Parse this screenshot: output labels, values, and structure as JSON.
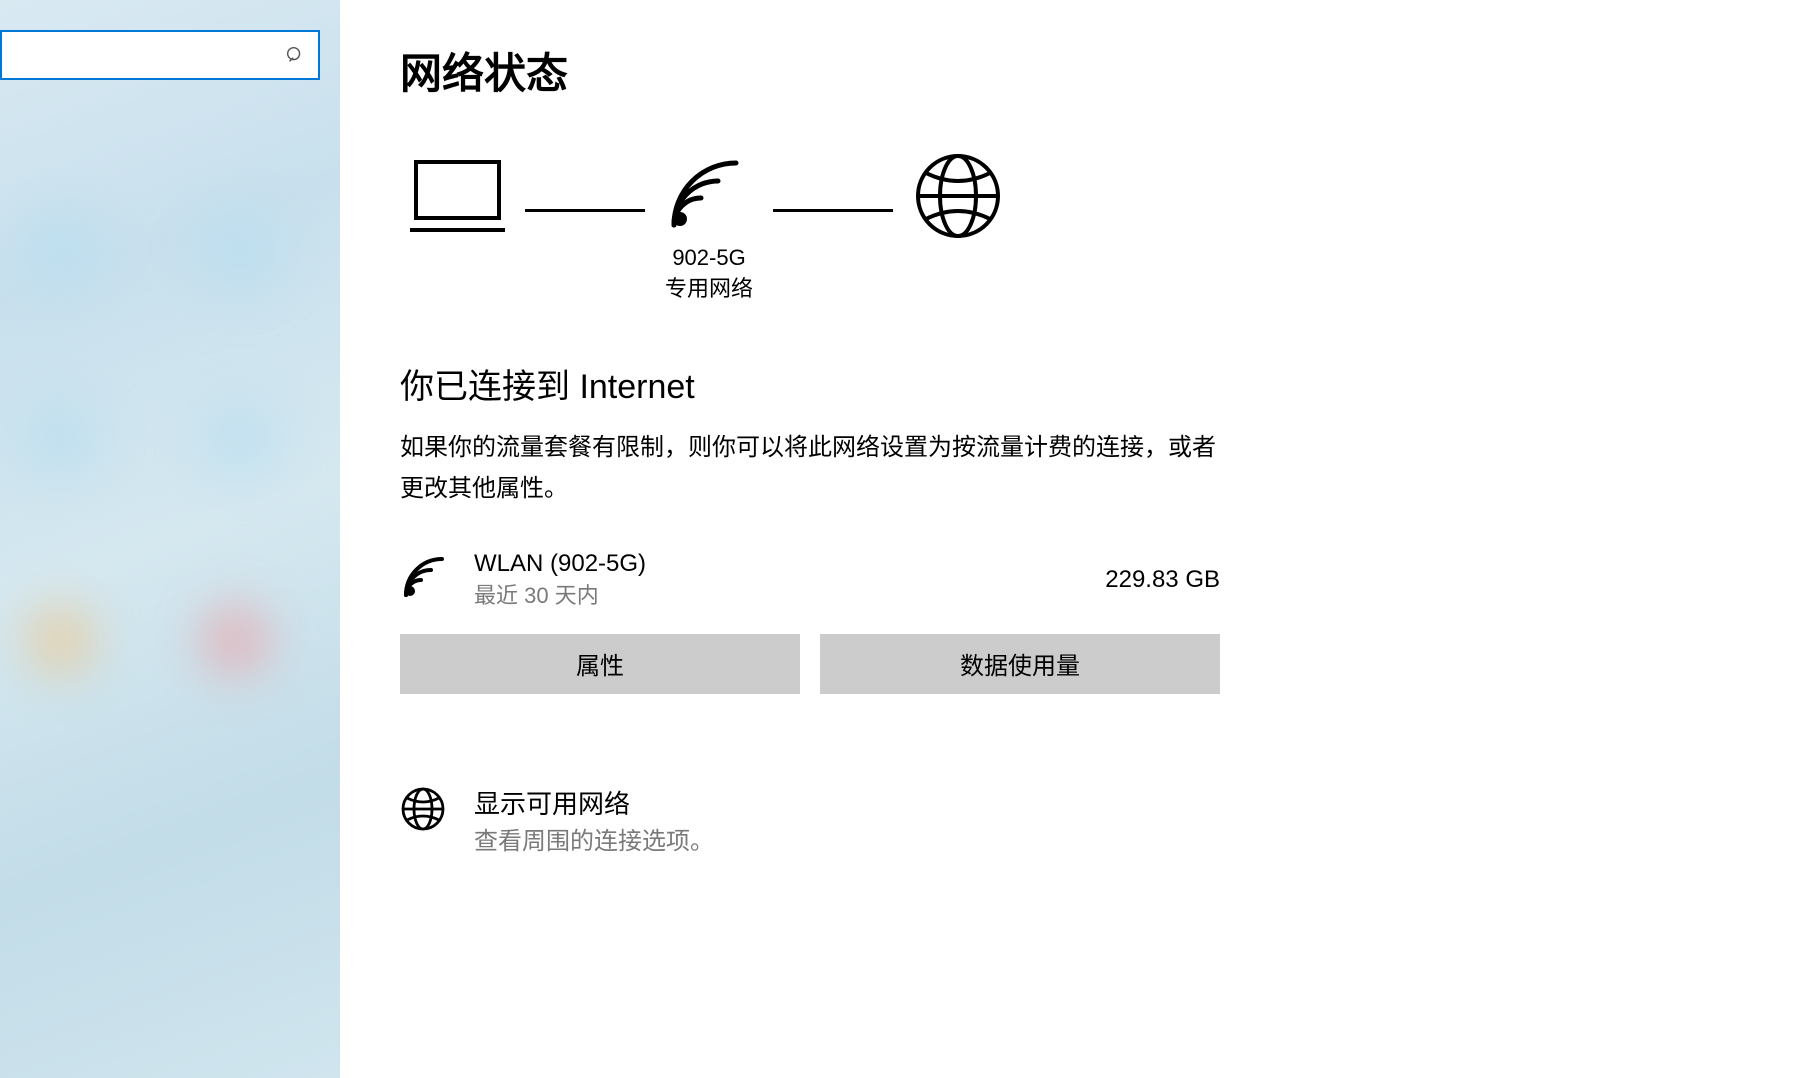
{
  "search": {
    "placeholder": ""
  },
  "page_title": "网络状态",
  "diagram": {
    "wifi_name": "902-5G",
    "wifi_type": "专用网络"
  },
  "connected_heading": "你已连接到 Internet",
  "description": "如果你的流量套餐有限制，则你可以将此网络设置为按流量计费的连接，或者更改其他属性。",
  "network": {
    "name": "WLAN (902-5G)",
    "period": "最近 30 天内",
    "usage": "229.83 GB"
  },
  "buttons": {
    "properties": "属性",
    "data_usage": "数据使用量"
  },
  "show_networks": {
    "title": "显示可用网络",
    "subtitle": "查看周围的连接选项。"
  }
}
